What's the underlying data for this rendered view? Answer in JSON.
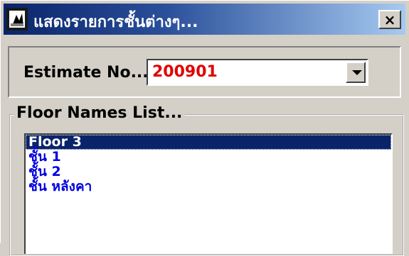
{
  "window": {
    "title": "แสดงรายการชั้นต่างๆ...",
    "close_label": "×"
  },
  "estimate": {
    "label": "Estimate No...",
    "value": "200901"
  },
  "floors": {
    "group_label": "Floor Names List...",
    "items": [
      "Floor 3",
      "ชั้น 1",
      "ชั้น 2",
      "ชั้น หลังคา"
    ],
    "selected_index": 0
  },
  "colors": {
    "titlebar_start": "#0a246a",
    "value_red": "#e00000",
    "list_text_blue": "#0000e0",
    "selection_bg": "#0a246a"
  }
}
